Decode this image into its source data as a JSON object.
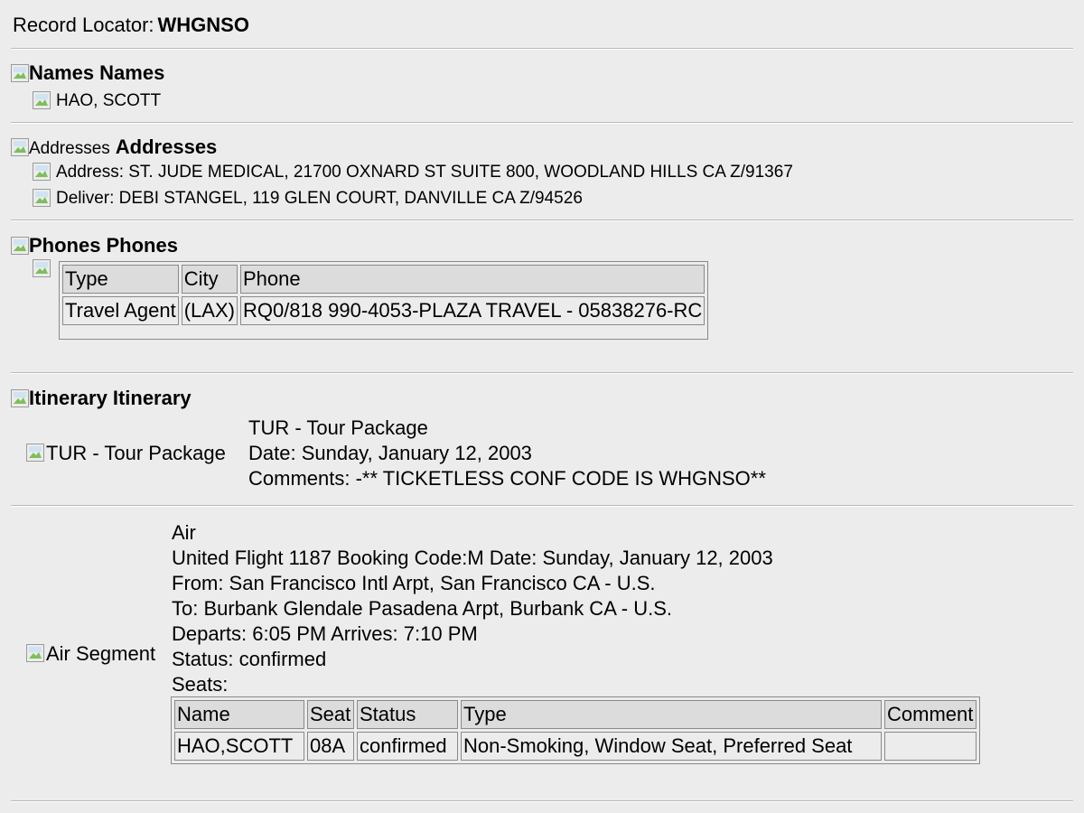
{
  "record": {
    "label": "Record Locator:",
    "value": "WHGNSO"
  },
  "names": {
    "alt": "Names",
    "title": "Names",
    "items": [
      "HAO, SCOTT"
    ]
  },
  "addresses": {
    "alt": "Addresses",
    "title": "Addresses",
    "items": [
      "Address: ST. JUDE MEDICAL, 21700 OXNARD ST SUITE 800, WOODLAND HILLS CA Z/91367",
      "Deliver: DEBI STANGEL, 119 GLEN COURT, DANVILLE CA Z/94526"
    ]
  },
  "phones": {
    "alt": "Phones",
    "title": "Phones",
    "headers": [
      "Type",
      "City",
      "Phone"
    ],
    "rows": [
      [
        "Travel Agent",
        "(LAX)",
        "RQ0/818 990-4053-PLAZA TRAVEL - 05838276-RC"
      ]
    ]
  },
  "itinerary": {
    "alt": "Itinerary",
    "title": "Itinerary",
    "tour": {
      "alt": "TUR - Tour Package",
      "lines": [
        "TUR - Tour Package",
        "Date: Sunday, January 12, 2003",
        "Comments: -** TICKETLESS CONF CODE IS WHGNSO**"
      ]
    },
    "air": {
      "alt": "Air Segment",
      "lines": [
        "Air",
        "United Flight 1187 Booking Code:M Date: Sunday, January 12, 2003",
        "From: San Francisco Intl Arpt, San Francisco CA - U.S.",
        "To: Burbank Glendale Pasadena Arpt, Burbank CA - U.S.",
        "Departs: 6:05 PM Arrives: 7:10 PM",
        "Status: confirmed",
        "Seats:"
      ],
      "seats": {
        "headers": [
          "Name",
          "Seat",
          "Status",
          "Type",
          "Comment"
        ],
        "rows": [
          [
            "HAO,SCOTT",
            "08A",
            "confirmed",
            "Non-Smoking, Window Seat, Preferred Seat",
            ""
          ]
        ]
      }
    }
  }
}
